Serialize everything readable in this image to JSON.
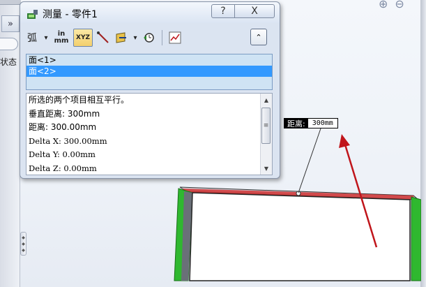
{
  "dialog": {
    "title": "测量 - 零件1",
    "help_label": "?",
    "close_label": "X",
    "expand_label": "⌃"
  },
  "toolbar": {
    "arc_circle_icon": "弧",
    "units_label_top": "in",
    "units_label_bottom": "mm",
    "xyz_label": "XYZ",
    "dropdown_arrow": "▾"
  },
  "selection": {
    "items": [
      "面<1>",
      "面<2>"
    ]
  },
  "results": {
    "lines": [
      "所选的两个项目相互平行。",
      "垂直距离: 300mm",
      "距离: 300.00mm",
      "Delta X: 300.00mm",
      "Delta Y: 0.00mm",
      "Delta Z: 0.00mm"
    ]
  },
  "measurement_tag": {
    "key": "距离:",
    "value": "300mm"
  },
  "left_panel": {
    "collapse_label": "»",
    "status_label": "状态"
  },
  "colors": {
    "accent_selected": "#3399ff",
    "highlight_edge": "#d03030",
    "face_green": "#2fb82f",
    "annotation_arrow": "#c0151b"
  }
}
